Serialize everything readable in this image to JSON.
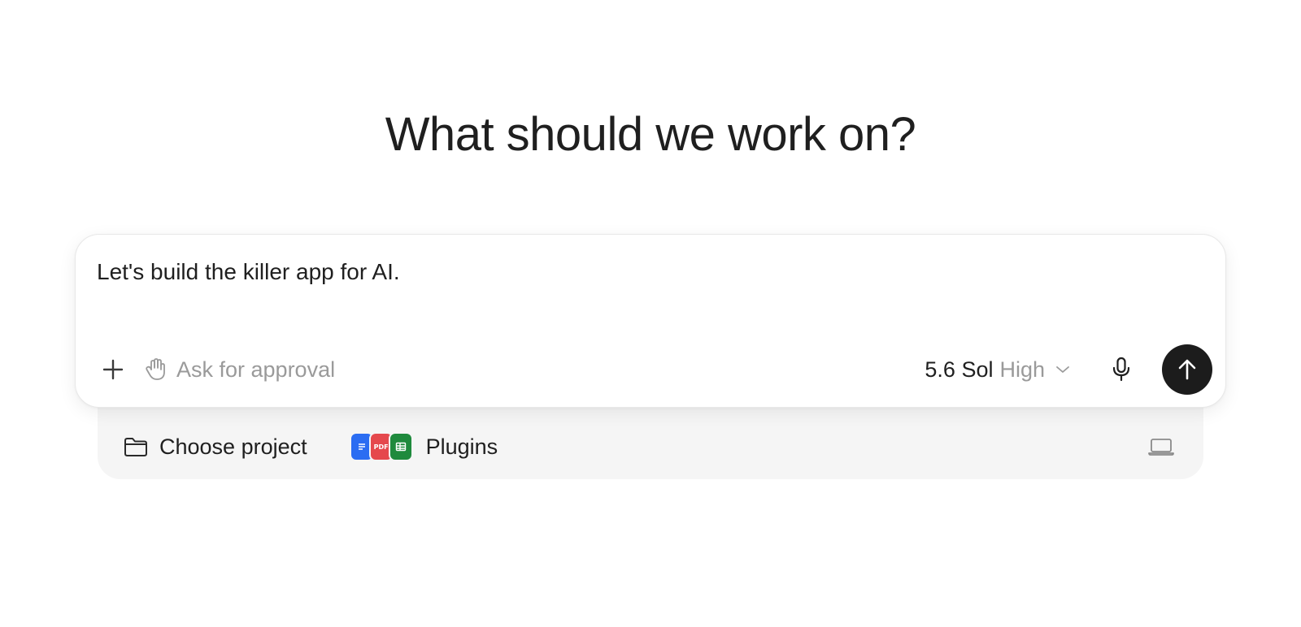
{
  "heading": "What should we work on?",
  "composer": {
    "input_value": "Let's build the killer app for AI.",
    "add_icon": "plus-icon",
    "approval": {
      "icon": "hand-icon",
      "label": "Ask for approval"
    },
    "model": {
      "name": "5.6 Sol",
      "effort": "High",
      "icon": "chevron-down-icon"
    },
    "mic_icon": "microphone-icon",
    "send_icon": "arrow-up-icon"
  },
  "subbar": {
    "project": {
      "icon": "folder-icon",
      "label": "Choose project"
    },
    "plugins": {
      "label": "Plugins",
      "icons": [
        {
          "name": "docs-plugin-icon",
          "color": "#2b6df2"
        },
        {
          "name": "pdf-plugin-icon",
          "color": "#e5484d",
          "label": "PDF"
        },
        {
          "name": "sheets-plugin-icon",
          "color": "#1f8a3d"
        }
      ]
    },
    "environment_icon": "laptop-icon"
  },
  "colors": {
    "send_button": "#1c1c1c",
    "muted_text": "#9a9a9a",
    "subbar_bg": "#f5f5f5"
  }
}
